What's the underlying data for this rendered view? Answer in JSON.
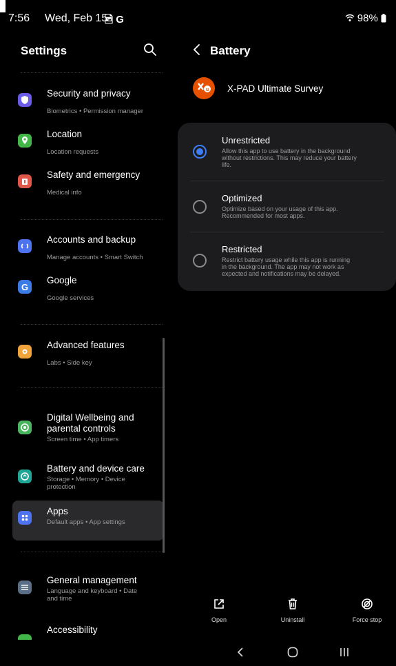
{
  "status": {
    "time": "7:56",
    "date": "Wed, Feb 15",
    "icons": "🖻 G",
    "right": "98%"
  },
  "settings": {
    "title": "Settings",
    "items": [
      {
        "title": "Security and privacy",
        "sub": "Biometrics • Permission manager",
        "color": "#6a5be8"
      },
      {
        "title": "Location",
        "sub": "Location requests",
        "color": "#43b649"
      },
      {
        "title": "Safety and emergency",
        "sub": "Medical info",
        "color": "#e0574a"
      },
      {
        "title": "Accounts and backup",
        "sub": "Manage accounts • Smart Switch",
        "color": "#4d73ef"
      },
      {
        "title": "Google",
        "sub": "Google services",
        "color": "#3a7be6"
      },
      {
        "title": "Advanced features",
        "sub": "Labs • Side key",
        "color": "#f0a33a"
      },
      {
        "title": "Digital Wellbeing and parental controls",
        "title1": "Digital Wellbeing and",
        "title2": "parental controls",
        "sub": "Screen time • App timers",
        "color": "#49b55e"
      },
      {
        "title": "Battery and device care",
        "sub1": "Storage • Memory • Device",
        "sub2": "protection",
        "color": "#1fa796"
      },
      {
        "title": "Apps",
        "sub": "Default apps • App settings",
        "color": "#4d73ef"
      },
      {
        "title": "General management",
        "sub1": "Language and keyboard • Date",
        "sub2": "and time",
        "color": "#5a6f86"
      },
      {
        "title": "Accessibility",
        "color": "#43b649"
      }
    ]
  },
  "battery": {
    "title": "Battery",
    "app_name": "X-PAD Ultimate Survey",
    "options": [
      {
        "title": "Unrestricted",
        "d1": "Allow this app to use battery in the background",
        "d2": "without restrictions. This may reduce your battery",
        "d3": "life.",
        "selected": true
      },
      {
        "title": "Optimized",
        "d1": "Optimize based on your usage of this app.",
        "d2": "Recommended for most apps.",
        "selected": false
      },
      {
        "title": "Restricted",
        "d1": "Restrict battery usage while this app is running",
        "d2": "in the background. The app may not work as",
        "d3": "expected and notifications may be delayed.",
        "selected": false
      }
    ]
  },
  "actions": {
    "open": "Open",
    "uninstall": "Uninstall",
    "force_stop": "Force stop"
  },
  "colors": {
    "accent": "#3e7cf4",
    "app_icon": "#e65100"
  }
}
